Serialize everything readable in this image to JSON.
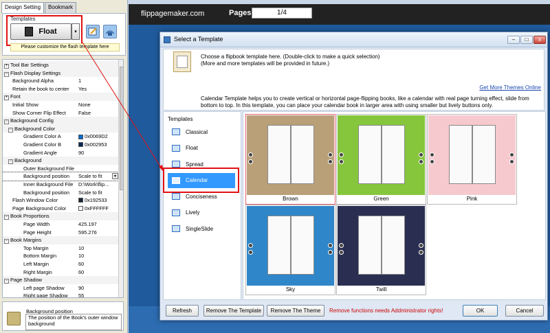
{
  "left_panel": {
    "tabs": [
      {
        "label": "Design Setting"
      },
      {
        "label": "Bookmark"
      }
    ],
    "templates_label": "Templates",
    "float_button": "Float",
    "dropdown_arrow": "▾",
    "customize_note": "Please customize the flash template here",
    "properties": [
      {
        "name": "Tool Bar Settings",
        "value": "",
        "level": 0,
        "toggle": "+"
      },
      {
        "name": "Flash Display Settings",
        "value": "",
        "level": 0,
        "toggle": "−"
      },
      {
        "name": "Background Alpha",
        "value": "1",
        "level": 2
      },
      {
        "name": "Retain the book to center",
        "value": "Yes",
        "level": 2
      },
      {
        "name": "Font",
        "value": "",
        "level": 0,
        "toggle": "+"
      },
      {
        "name": "Initial Show",
        "value": "None",
        "level": 2
      },
      {
        "name": "Show Corner Flip Effect",
        "value": "False",
        "level": 2
      },
      {
        "name": "Background Config",
        "value": "",
        "level": 0,
        "toggle": "−"
      },
      {
        "name": "Background Color",
        "value": "",
        "level": 1,
        "toggle": "−"
      },
      {
        "name": "Gradient Color A",
        "value": "0x0069D2",
        "level": 3,
        "swatch": "#0069D2"
      },
      {
        "name": "Gradient Color B",
        "value": "0x002953",
        "level": 3,
        "swatch": "#002953"
      },
      {
        "name": "Gradient Angle",
        "value": "90",
        "level": 3
      },
      {
        "name": "Background",
        "value": "",
        "level": 1,
        "toggle": "−"
      },
      {
        "name": "Outer Background File",
        "value": "",
        "level": 3
      },
      {
        "name": "Background position",
        "value": "Scale to fit",
        "level": 3,
        "dropdown": true,
        "highlight": true
      },
      {
        "name": "Inner Background File",
        "value": "D:\\Work\\flip...",
        "level": 3
      },
      {
        "name": "Background position",
        "value": "Scale to fit",
        "level": 3
      },
      {
        "name": "Flash Window Color",
        "value": "0x192533",
        "level": 2,
        "swatch": "#192533"
      },
      {
        "name": "Page Background Color",
        "value": "0xFFFFFF",
        "level": 2,
        "swatch": "#FFFFFF"
      },
      {
        "name": "Book Proportions",
        "value": "",
        "level": 0,
        "toggle": "−"
      },
      {
        "name": "Page Width",
        "value": "425.197",
        "level": 3
      },
      {
        "name": "Page Height",
        "value": "595.276",
        "level": 3
      },
      {
        "name": "Book Margins",
        "value": "",
        "level": 0,
        "toggle": "−"
      },
      {
        "name": "Top Margin",
        "value": "10",
        "level": 3
      },
      {
        "name": "Bottom Margin",
        "value": "10",
        "level": 3
      },
      {
        "name": "Left Margin",
        "value": "60",
        "level": 3
      },
      {
        "name": "Right Margin",
        "value": "60",
        "level": 3
      },
      {
        "name": "Page Shadow",
        "value": "",
        "level": 0,
        "toggle": "−"
      },
      {
        "name": "Left page Shadow",
        "value": "90",
        "level": 3
      },
      {
        "name": "Right page Shadow",
        "value": "55",
        "level": 3
      }
    ],
    "help": {
      "title": "Background position",
      "text": "The position of the Book's outer window background"
    }
  },
  "preview": {
    "title": "flippagemaker.com",
    "pages_label": "Pages:",
    "pages_value": "1/4"
  },
  "dialog": {
    "title": "Select a Template",
    "window_buttons": {
      "min": "–",
      "max": "□",
      "close": "x"
    },
    "info": {
      "line1": "Choose a flipbook template here. (Double-click to make a quick selection)",
      "line2": "(More and more templates will be provided in future.)",
      "link": "Get More Themes Online",
      "desc1": "Calendar Template helps you to create vertical or horizontal page-flipping books, like a calendar with real page turning effect, slide from",
      "desc2": "bottom to top. In this template, you can place your calendar book in larger area with using smaller but lively buttons only."
    },
    "templates_header": "Templates",
    "templates": [
      {
        "label": "Classical"
      },
      {
        "label": "Float"
      },
      {
        "label": "Spread"
      },
      {
        "label": "Calendar"
      },
      {
        "label": "Conciseness"
      },
      {
        "label": "Lively"
      },
      {
        "label": "SingleSlide"
      }
    ],
    "selected_template": "Calendar",
    "themes": [
      {
        "name": "Brown",
        "color": "#b9a078"
      },
      {
        "name": "Green",
        "color": "#86c63c"
      },
      {
        "name": "Pink",
        "color": "#f6c9cf"
      },
      {
        "name": "Sky",
        "color": "#2f86c8"
      },
      {
        "name": "Twill",
        "color": "#2a2f52"
      }
    ],
    "selected_theme": "Brown",
    "buttons": {
      "refresh": "Refresh",
      "remove_template": "Remove The Template",
      "remove_theme": "Remove The Theme",
      "ok": "OK",
      "cancel": "Cancel"
    },
    "warning": "Remove functions needs Addministrator rights!"
  },
  "colors": {
    "highlight_red": "#e01010",
    "selection_blue": "#3399ff",
    "link_blue": "#1a47b0"
  }
}
